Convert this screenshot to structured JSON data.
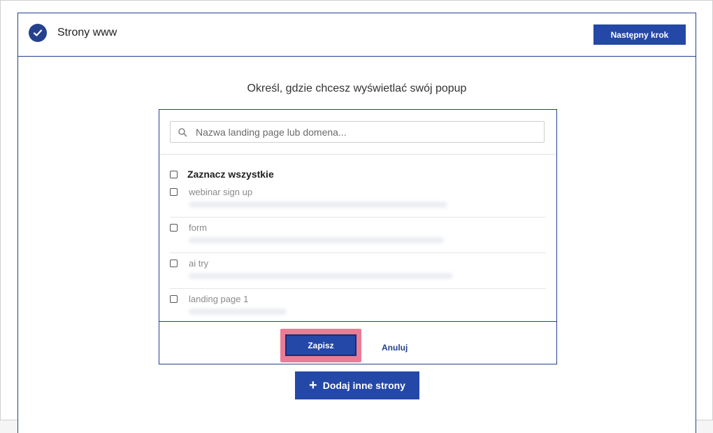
{
  "header": {
    "title": "Strony www",
    "next_label": "Następny krok"
  },
  "main": {
    "subtitle": "Określ, gdzie chcesz wyświetlać swój popup"
  },
  "search": {
    "placeholder": "Nazwa landing page lub domena..."
  },
  "list": {
    "select_all_label": "Zaznacz wszystkie",
    "items": [
      {
        "name": "webinar sign up"
      },
      {
        "name": "form"
      },
      {
        "name": "ai try"
      },
      {
        "name": "landing page 1"
      }
    ]
  },
  "footer": {
    "save_label": "Zapisz",
    "cancel_label": "Anuluj"
  },
  "add": {
    "label": "Dodaj inne strony"
  },
  "colors": {
    "primary": "#2448a8",
    "border": "#24418f",
    "highlight": "#ea7c96"
  }
}
